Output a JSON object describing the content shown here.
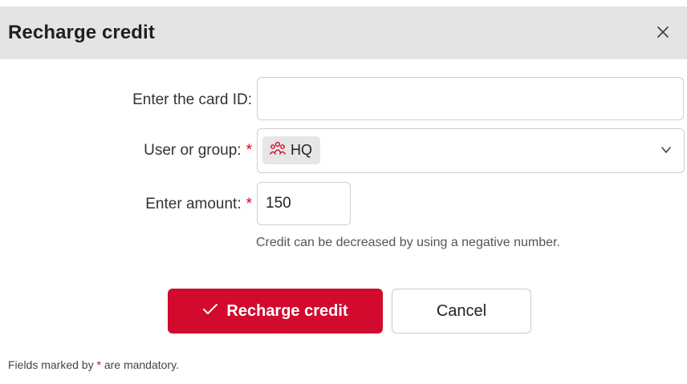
{
  "dialog": {
    "title": "Recharge credit",
    "close_icon": "close-icon"
  },
  "form": {
    "card_id": {
      "label": "Enter the card ID:",
      "value": "",
      "placeholder": ""
    },
    "user_group": {
      "label": "User or group:",
      "required_mark": "*",
      "selected_chip": "HQ",
      "chip_icon": "group-icon",
      "dropdown_icon": "chevron-down-icon"
    },
    "amount": {
      "label": "Enter amount:",
      "required_mark": "*",
      "value": "150",
      "hint": "Credit can be decreased by using a negative number."
    }
  },
  "buttons": {
    "recharge_label": "Recharge credit",
    "recharge_icon": "checkmark-icon",
    "cancel_label": "Cancel"
  },
  "footer": {
    "prefix": "Fields marked by",
    "star": "*",
    "suffix": "are mandatory."
  },
  "colors": {
    "accent": "#d10a2e",
    "required": "#d0021b",
    "titlebar": "#e4e4e4"
  }
}
